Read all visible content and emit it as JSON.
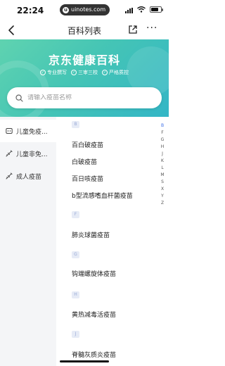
{
  "status_bar": {
    "time": "22:24",
    "url": "uinotes.com",
    "url_badge": "u",
    "battery_level": 0.8
  },
  "nav": {
    "title": "百科列表",
    "back_icon": "back-arrow-icon",
    "share_icon": "share-icon",
    "more_label": "···"
  },
  "banner": {
    "title": "京东健康百科",
    "tags": [
      "专业撰写",
      "三审三校",
      "严格质控"
    ],
    "tag_check": "✓",
    "colors": {
      "start": "#5fd3b0",
      "end": "#33b6c6"
    }
  },
  "search": {
    "placeholder": "请输入疫苗名称",
    "value": ""
  },
  "sidebar": {
    "items": [
      {
        "label": "儿童免疫...",
        "icon": "baby-icon"
      },
      {
        "label": "儿童非免...",
        "icon": "syringe-icon"
      },
      {
        "label": "成人疫苗",
        "icon": "syringe-icon"
      }
    ]
  },
  "list": {
    "sections": [
      {
        "letter": "B",
        "items": [
          "百白破疫苗",
          "白破疫苗",
          "百日咳疫苗",
          "b型流感嗜血杆菌疫苗"
        ]
      },
      {
        "letter": "F",
        "items": [
          "肺炎球菌疫苗"
        ]
      },
      {
        "letter": "G",
        "items": [
          "钩端螺旋体疫苗"
        ]
      },
      {
        "letter": "H",
        "items": [
          "黄热减毒活疫苗"
        ]
      },
      {
        "letter": "J",
        "items": [
          "脊髓灰质炎疫苗"
        ]
      }
    ]
  },
  "index_bar": {
    "letters": [
      "B",
      "F",
      "G",
      "H",
      "J",
      "K",
      "L",
      "M",
      "S",
      "X",
      "Y",
      "Z"
    ],
    "active": "B"
  },
  "colors": {
    "accent": "#3b6de8",
    "section_badge_bg": "#e6ebf6",
    "sidebar_bg": "#f4f5f7"
  }
}
